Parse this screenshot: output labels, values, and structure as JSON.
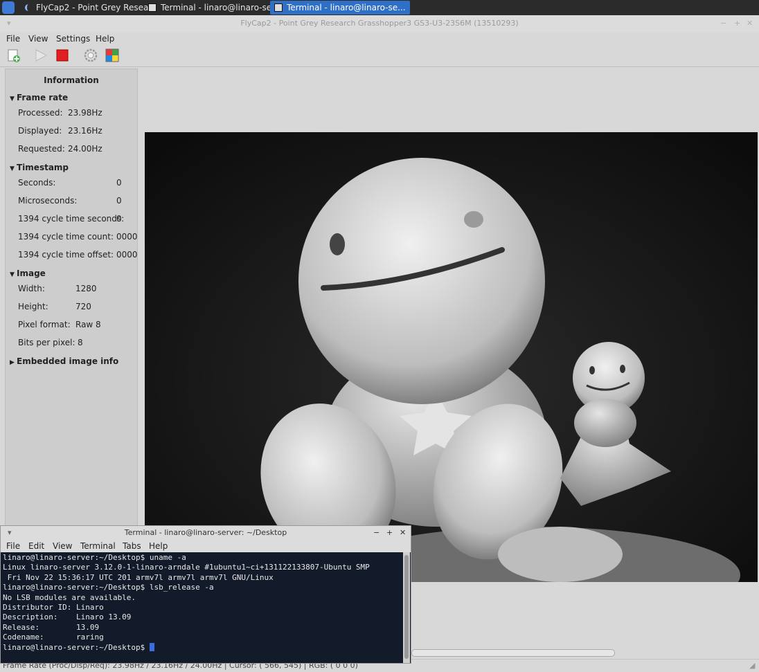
{
  "taskbar": {
    "tasks": [
      {
        "label": "FlyCap2 - Point Grey Resea..."
      },
      {
        "label": "Terminal - linaro@linaro-se..."
      },
      {
        "label": "Terminal - linaro@linaro-se..."
      }
    ]
  },
  "window": {
    "title": "FlyCap2 - Point Grey Research Grasshopper3 GS3-U3-23S6M (13510293)"
  },
  "menubar": [
    "File",
    "View",
    "Settings",
    "Help"
  ],
  "info": {
    "title": "Information",
    "frame_rate": {
      "label": "Frame rate",
      "rows": [
        {
          "label": "Processed:",
          "value": "23.98Hz"
        },
        {
          "label": "Displayed:",
          "value": "23.16Hz"
        },
        {
          "label": "Requested:",
          "value": "24.00Hz"
        }
      ]
    },
    "timestamp": {
      "label": "Timestamp",
      "rows": [
        {
          "label": "Seconds:",
          "value": "0"
        },
        {
          "label": "Microseconds:",
          "value": "0"
        },
        {
          "label": "1394 cycle time seconds:",
          "value": "0"
        },
        {
          "label": "1394 cycle time count:",
          "value": "0000"
        },
        {
          "label": "1394 cycle time offset:",
          "value": "0000"
        }
      ]
    },
    "image": {
      "label": "Image",
      "rows": [
        {
          "label": "Width:",
          "value": "1280"
        },
        {
          "label": "Height:",
          "value": "720"
        },
        {
          "label": "Pixel format:",
          "value": "Raw 8"
        },
        {
          "label": "Bits per pixel:",
          "value": "8"
        }
      ]
    },
    "embedded": {
      "label": "Embedded image info"
    }
  },
  "statusbar": {
    "text": "Frame Rate (Proc/Disp/Req): 23.98Hz / 23.16Hz / 24.00Hz | Cursor: ( 566,  545) | RGB: ( 0  0  0)"
  },
  "terminal": {
    "title": "Terminal - linaro@linaro-server: ~/Desktop",
    "menu": [
      "File",
      "Edit",
      "View",
      "Terminal",
      "Tabs",
      "Help"
    ],
    "lines": [
      "linaro@linaro-server:~/Desktop$ uname -a",
      "Linux linaro-server 3.12.0-1-linaro-arndale #1ubuntu1~ci+131122133807-Ubuntu SMP",
      " Fri Nov 22 15:36:17 UTC 201 armv7l armv7l armv7l GNU/Linux",
      "linaro@linaro-server:~/Desktop$ lsb_release -a",
      "No LSB modules are available.",
      "Distributor ID: Linaro",
      "Description:    Linaro 13.09",
      "Release:        13.09",
      "Codename:       raring"
    ],
    "prompt": "linaro@linaro-server:~/Desktop$ "
  }
}
